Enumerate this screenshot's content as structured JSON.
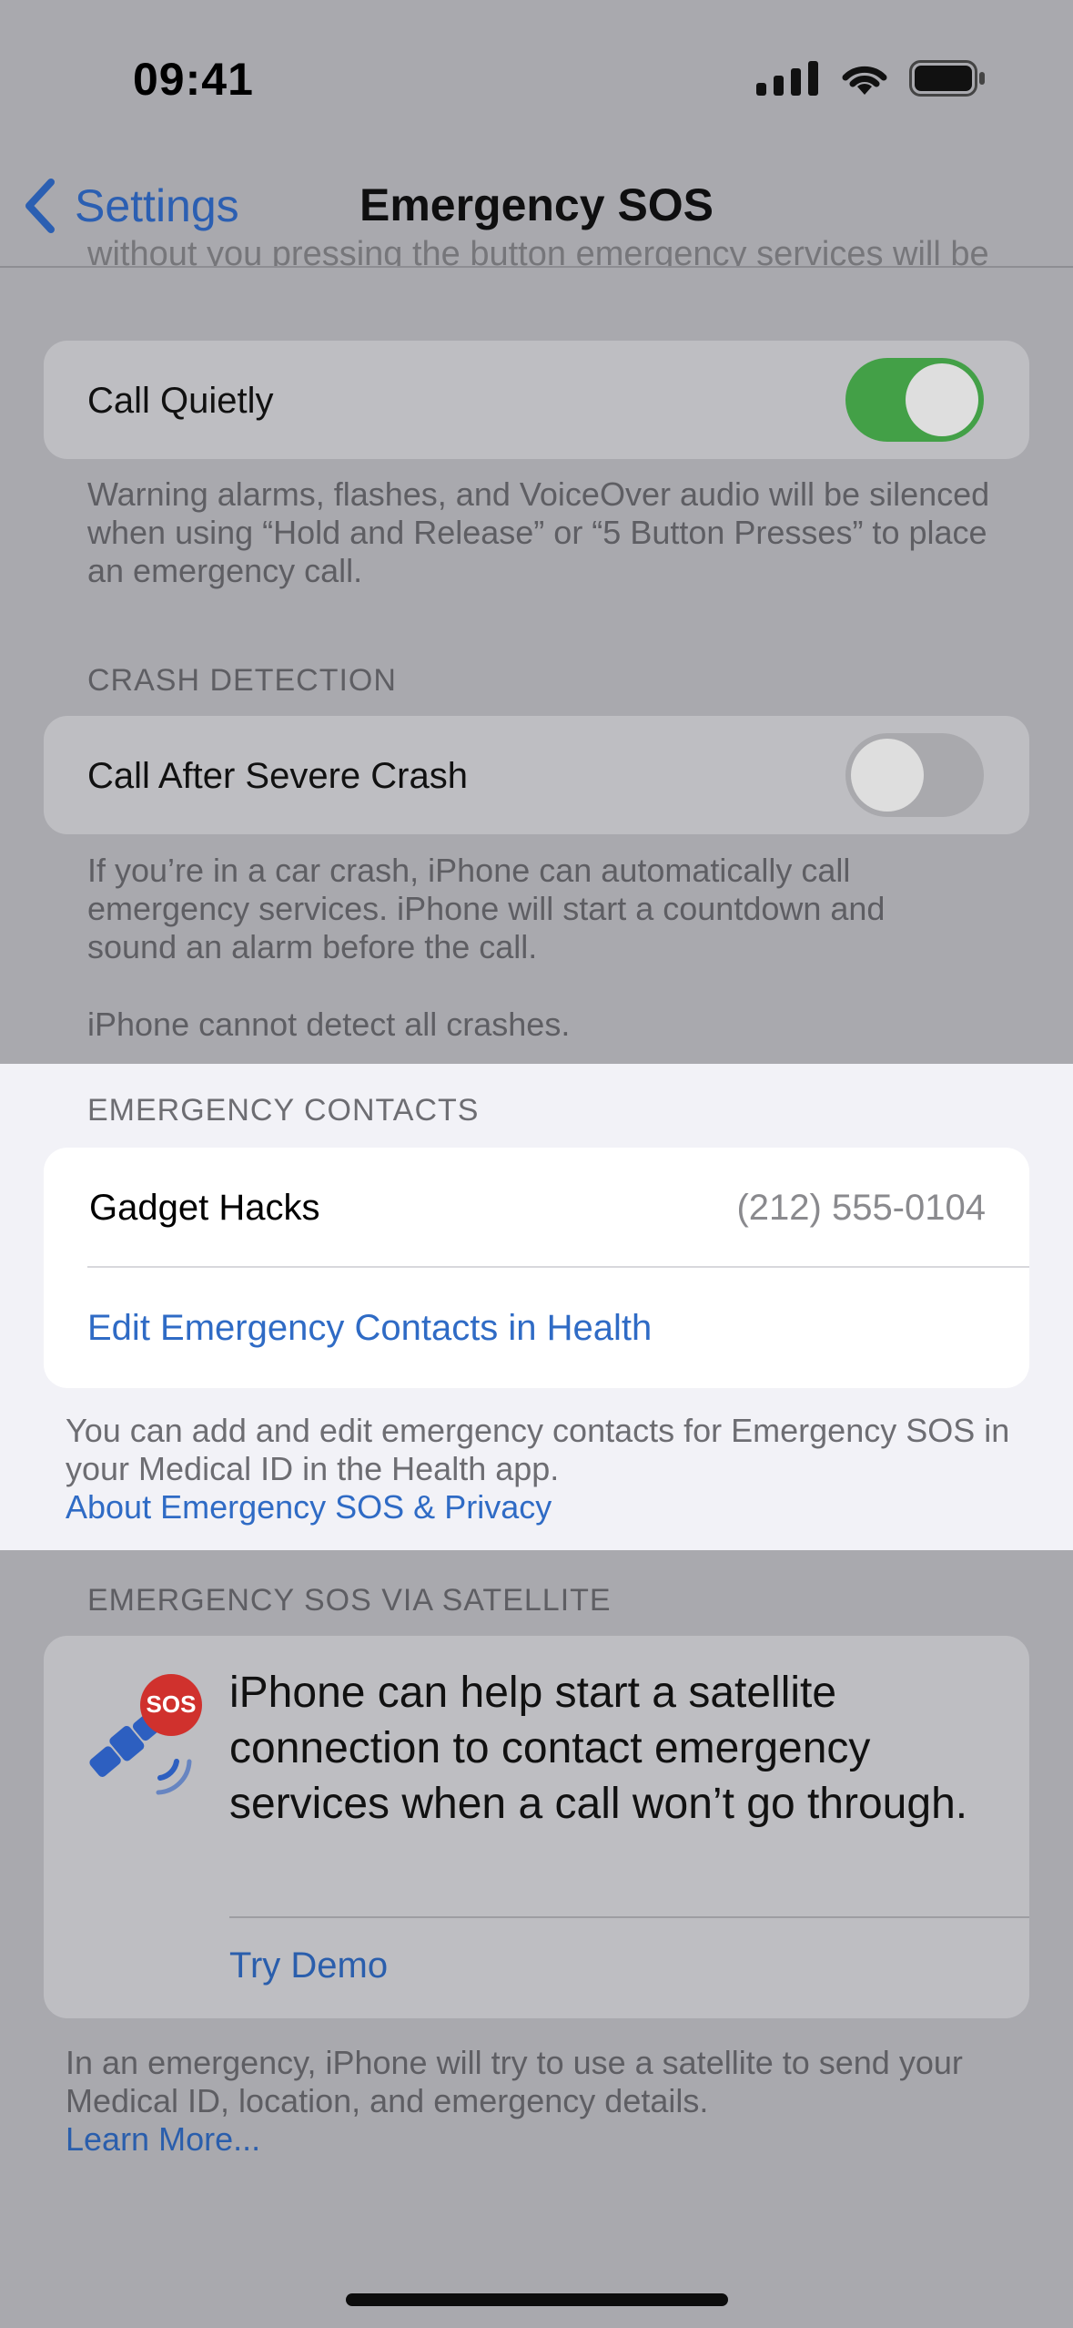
{
  "status_bar": {
    "time": "09:41"
  },
  "nav": {
    "back_label": "Settings",
    "title": "Emergency SOS"
  },
  "cropped_text": "without you pressing the button emergency services will be",
  "call_quietly": {
    "label": "Call Quietly",
    "enabled": true,
    "footnote": "Warning alarms, flashes, and VoiceOver audio will be silenced when using “Hold and Release” or “5 Button Presses” to place an emergency call."
  },
  "crash_detection": {
    "header": "CRASH DETECTION",
    "label": "Call After Severe Crash",
    "enabled": false,
    "footnote_1": "If you’re in a car crash, iPhone can automatically call emergency services. iPhone will start a countdown and sound an alarm before the call.",
    "footnote_2": "iPhone cannot detect all crashes."
  },
  "emergency_contacts": {
    "header": "EMERGENCY CONTACTS",
    "contact_name": "Gadget Hacks",
    "contact_phone": "(212) 555-0104",
    "edit_link": "Edit Emergency Contacts in Health",
    "footnote": "You can add and edit emergency contacts for Emergency SOS in your Medical ID in the Health app.",
    "privacy_link": "About Emergency SOS & Privacy"
  },
  "satellite": {
    "header": "EMERGENCY SOS VIA SATELLITE",
    "sos_badge": "SOS",
    "description": "iPhone can help start a satellite connection to contact emergency services when a call won’t go through.",
    "demo_link": "Try Demo",
    "footnote": "In an emergency, iPhone will try to use a satellite to send your Medical ID, location, and emergency details.",
    "learn_more": "Learn More..."
  },
  "colors": {
    "toggle_on": "#43a047",
    "toggle_off": "#a9a9ad",
    "link": "#2f6bc5",
    "sos_red": "#d0312d",
    "satellite_blue": "#2d5fc0"
  }
}
